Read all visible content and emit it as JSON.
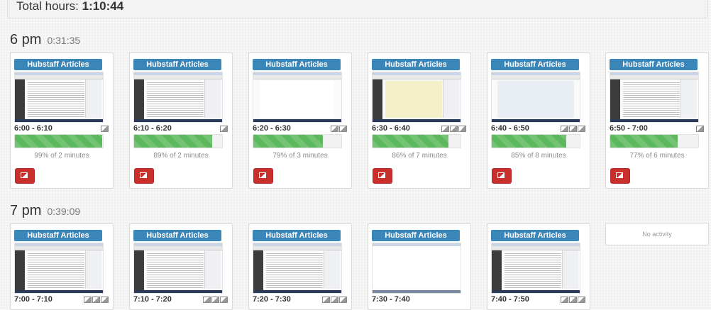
{
  "total": {
    "label": "Total hours: ",
    "value": "1:10:44"
  },
  "hours": [
    {
      "hour": "6 pm",
      "duration": "0:31:35",
      "cards": [
        {
          "project": "Hubstaff Articles",
          "time": "6:00 - 6:10",
          "activity": 0.99,
          "activity_text": "99% of 2 minutes"
        },
        {
          "project": "Hubstaff Articles",
          "time": "6:10 - 6:20",
          "activity": 0.89,
          "activity_text": "89% of 2 minutes"
        },
        {
          "project": "Hubstaff Articles",
          "time": "6:20 - 6:30",
          "activity": 0.79,
          "activity_text": "79% of 3 minutes"
        },
        {
          "project": "Hubstaff Articles",
          "time": "6:30 - 6:40",
          "activity": 0.86,
          "activity_text": "86% of 7 minutes"
        },
        {
          "project": "Hubstaff Articles",
          "time": "6:40 - 6:50",
          "activity": 0.85,
          "activity_text": "85% of 8 minutes"
        },
        {
          "project": "Hubstaff Articles",
          "time": "6:50 - 7:00",
          "activity": 0.77,
          "activity_text": "77% of 6 minutes"
        }
      ]
    },
    {
      "hour": "7 pm",
      "duration": "0:39:09",
      "cards": [
        {
          "project": "Hubstaff Articles",
          "time": "7:00 - 7:10"
        },
        {
          "project": "Hubstaff Articles",
          "time": "7:10 - 7:20"
        },
        {
          "project": "Hubstaff Articles",
          "time": "7:20 - 7:30"
        },
        {
          "project": "Hubstaff Articles",
          "time": "7:30 - 7:40"
        },
        {
          "project": "Hubstaff Articles",
          "time": "7:40 - 7:50"
        }
      ],
      "no_activity_text": "No activity"
    }
  ],
  "colors": {
    "project_badge": "#3b86b8",
    "activity_bar": "#5cb85c",
    "delete_button": "#c9302c"
  }
}
